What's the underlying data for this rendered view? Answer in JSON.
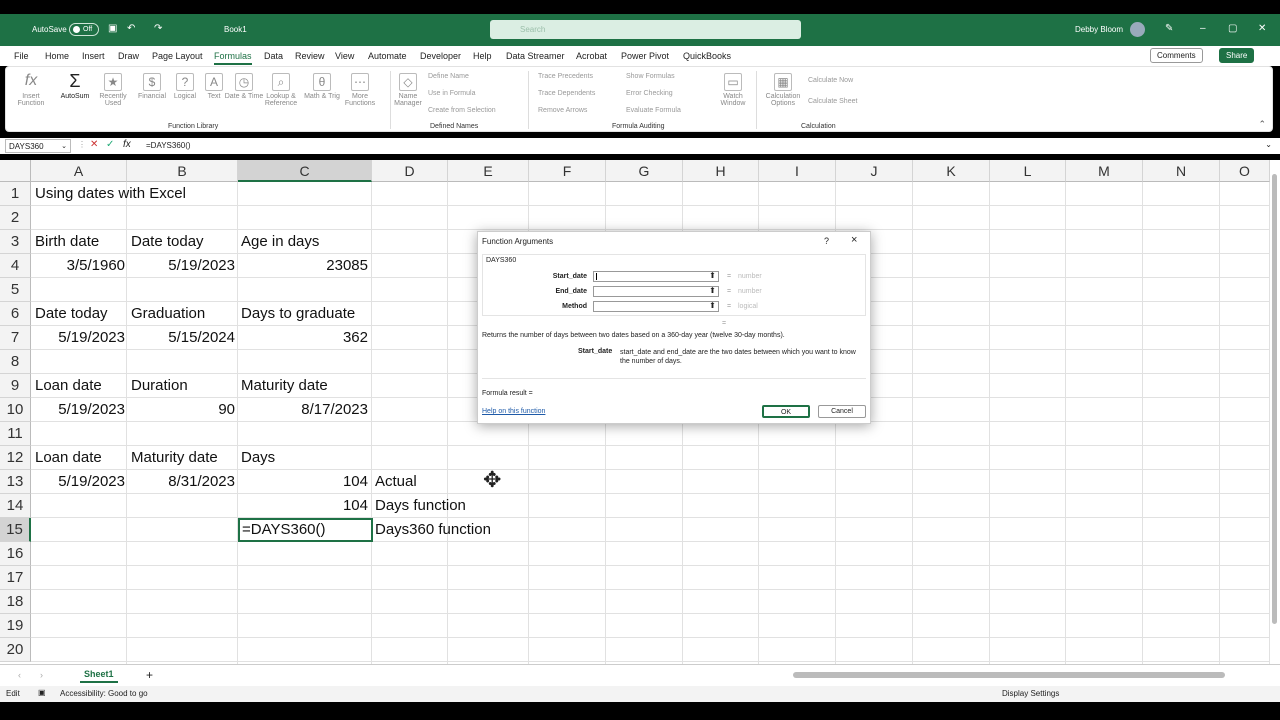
{
  "titlebar": {
    "autosave": "AutoSave",
    "toggle": "Off",
    "doc": "Book1",
    "search": "Search",
    "user": "Debby Bloom"
  },
  "menu": {
    "items": [
      "File",
      "Home",
      "Insert",
      "Draw",
      "Page Layout",
      "Formulas",
      "Data",
      "Review",
      "View",
      "Automate",
      "Developer",
      "Help",
      "Data Streamer",
      "Acrobat",
      "Power Pivot",
      "QuickBooks"
    ],
    "comments": "Comments",
    "share": "Share"
  },
  "ribbon": {
    "fx": "Insert Function",
    "buttons": [
      "AutoSum",
      "Recently Used",
      "Financial",
      "Logical",
      "Text",
      "Date & Time",
      "Lookup & Reference",
      "Math & Trig",
      "More Functions"
    ],
    "name_manager": "Name Manager",
    "defined": [
      "Define Name",
      "Use in Formula",
      "Create from Selection"
    ],
    "auditing": [
      "Trace Precedents",
      "Trace Dependents",
      "Remove Arrows",
      "Show Formulas",
      "Error Checking",
      "Evaluate Formula"
    ],
    "watch": "Watch Window",
    "calc_options": "Calculation Options",
    "calc": [
      "Calculate Now",
      "Calculate Sheet"
    ],
    "groups": [
      "Function Library",
      "Defined Names",
      "Formula Auditing",
      "Calculation"
    ]
  },
  "formula_bar": {
    "name_box": "DAYS360",
    "formula": "=DAYS360()"
  },
  "columns": [
    "A",
    "B",
    "C",
    "D",
    "E",
    "F",
    "G",
    "H",
    "I",
    "J",
    "K",
    "L",
    "M",
    "N",
    "O"
  ],
  "rows": [
    "1",
    "2",
    "3",
    "4",
    "5",
    "6",
    "7",
    "8",
    "9",
    "10",
    "11",
    "12",
    "13",
    "14",
    "15",
    "16",
    "17",
    "18",
    "19",
    "20"
  ],
  "cells": {
    "a1": "Using dates with Excel",
    "a3": "Birth date",
    "b3": "Date today",
    "c3": "Age in days",
    "a4": "3/5/1960",
    "b4": "5/19/2023",
    "c4": "23085",
    "a6": "Date today",
    "b6": "Graduation",
    "c6": "Days to graduate",
    "a7": "5/19/2023",
    "b7": "5/15/2024",
    "c7": "362",
    "a9": "Loan date",
    "b9": "Duration",
    "c9": "Maturity date",
    "a10": "5/19/2023",
    "b10": "90",
    "c10": "8/17/2023",
    "a12": "Loan date",
    "b12": "Maturity date",
    "c12": "Days",
    "a13": "5/19/2023",
    "b13": "8/31/2023",
    "c13": "104",
    "d13": "Actual",
    "c14": "104",
    "d14": "Days function",
    "c15": "=DAYS360()",
    "d15": "Days360 function"
  },
  "sheet_tab": "Sheet1",
  "status": {
    "mode": "Edit",
    "accessibility": "Accessibility: Good to go",
    "display": "Display Settings"
  },
  "dialog": {
    "title": "Function Arguments",
    "help_char": "?",
    "close_char": "×",
    "func": "DAYS360",
    "args": [
      {
        "label": "Start_date",
        "type": "number"
      },
      {
        "label": "End_date",
        "type": "number"
      },
      {
        "label": "Method",
        "type": "logical"
      }
    ],
    "eq": "=",
    "description": "Returns the number of days between two dates based on a 360-day year (twelve 30-day months).",
    "arg_name": "Start_date",
    "arg_desc": "start_date and end_date are the two dates between which you want to know the number of days.",
    "result": "Formula result =",
    "help_link": "Help on this function",
    "ok": "OK",
    "cancel": "Cancel"
  }
}
